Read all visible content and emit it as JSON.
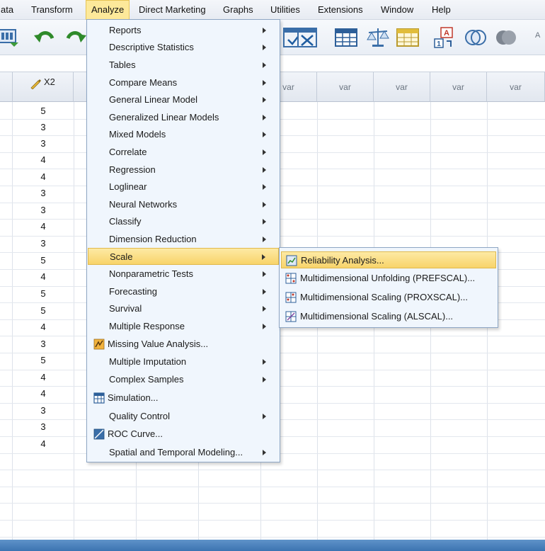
{
  "menubar": {
    "items": [
      "ata",
      "Transform",
      "Analyze",
      "Direct Marketing",
      "Graphs",
      "Utilities",
      "Extensions",
      "Window",
      "Help"
    ],
    "active": "Analyze"
  },
  "toolbar": {
    "icons": [
      "open-data-icon",
      "undo-icon",
      "redo-icon",
      "goto-case-icon",
      "goto-variable-icon",
      "variables-icon",
      "weight-cases-icon",
      "split-file-icon",
      "value-labels-icon",
      "use-sets-icon",
      "spelling-icon"
    ]
  },
  "grid": {
    "x2_header": "X2",
    "var_header": "var",
    "x2_values": [
      "5",
      "3",
      "3",
      "4",
      "4",
      "3",
      "3",
      "4",
      "3",
      "5",
      "4",
      "5",
      "5",
      "4",
      "3",
      "5",
      "4",
      "4",
      "3",
      "3",
      "4"
    ]
  },
  "analyze_menu": {
    "items": [
      {
        "label": "Reports",
        "submenu": true
      },
      {
        "label": "Descriptive Statistics",
        "submenu": true
      },
      {
        "label": "Tables",
        "submenu": true
      },
      {
        "label": "Compare Means",
        "submenu": true
      },
      {
        "label": "General Linear Model",
        "submenu": true
      },
      {
        "label": "Generalized Linear Models",
        "submenu": true
      },
      {
        "label": "Mixed Models",
        "submenu": true
      },
      {
        "label": "Correlate",
        "submenu": true
      },
      {
        "label": "Regression",
        "submenu": true
      },
      {
        "label": "Loglinear",
        "submenu": true
      },
      {
        "label": "Neural Networks",
        "submenu": true
      },
      {
        "label": "Classify",
        "submenu": true
      },
      {
        "label": "Dimension Reduction",
        "submenu": true
      },
      {
        "label": "Scale",
        "submenu": true
      },
      {
        "label": "Nonparametric Tests",
        "submenu": true
      },
      {
        "label": "Forecasting",
        "submenu": true
      },
      {
        "label": "Survival",
        "submenu": true
      },
      {
        "label": "Multiple Response",
        "submenu": true
      },
      {
        "label": "Missing Value Analysis...",
        "submenu": false
      },
      {
        "label": "Multiple Imputation",
        "submenu": true
      },
      {
        "label": "Complex Samples",
        "submenu": true
      },
      {
        "label": "Simulation...",
        "submenu": false
      },
      {
        "label": "Quality Control",
        "submenu": true
      },
      {
        "label": "ROC Curve...",
        "submenu": false
      },
      {
        "label": "Spatial and Temporal Modeling...",
        "submenu": true
      }
    ],
    "highlighted": "Scale"
  },
  "scale_submenu": {
    "items": [
      {
        "label": "Reliability Analysis..."
      },
      {
        "label": "Multidimensional Unfolding (PREFSCAL)..."
      },
      {
        "label": "Multidimensional Scaling (PROXSCAL)..."
      },
      {
        "label": "Multidimensional Scaling (ALSCAL)..."
      }
    ],
    "highlighted": "Reliability Analysis..."
  },
  "colors": {
    "highlight": "#f8d46a",
    "menu_bg": "#f0f6fd",
    "bottom_bar": "#3c74b1"
  }
}
